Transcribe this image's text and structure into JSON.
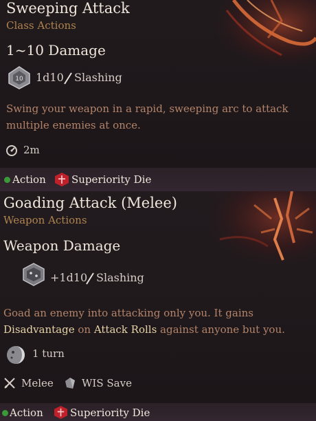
{
  "tooltips": [
    {
      "title": "Sweeping Attack",
      "category": "Class Actions",
      "damage_heading": "1~10 Damage",
      "roll": "1d10",
      "damage_type": "Slashing",
      "description": "Swing your weapon in a rapid, sweeping arc to attack multiple enemies at once.",
      "range": "2m",
      "footer": {
        "cost_action": "Action",
        "cost_resource": "Superiority Die"
      }
    },
    {
      "title": "Goading Attack (Melee)",
      "category": "Weapon Actions",
      "damage_heading": "Weapon Damage",
      "roll": "+1d10",
      "damage_type": "Slashing",
      "description_parts": {
        "p1": "Goad an enemy into attacking only you. It gains ",
        "link1": "Disadvantage",
        "p2": " on ",
        "link2": "Attack Rolls",
        "p3": " against anyone but you."
      },
      "duration": "1 turn",
      "attack_type": "Melee",
      "save": "WIS Save",
      "footer": {
        "cost_action": "Action",
        "cost_resource": "Superiority Die"
      }
    }
  ],
  "colors": {
    "action_dot": "#3a9a3a",
    "resource_icon": "#c0202a",
    "heading": "#efe7dc",
    "category": "#b0834f",
    "description": "#b4846a"
  },
  "icons": [
    "dice-icon",
    "slash-icon",
    "range-icon",
    "duration-icon",
    "melee-icon",
    "save-icon",
    "action-dot-icon",
    "superiority-die-icon",
    "ability-art"
  ]
}
